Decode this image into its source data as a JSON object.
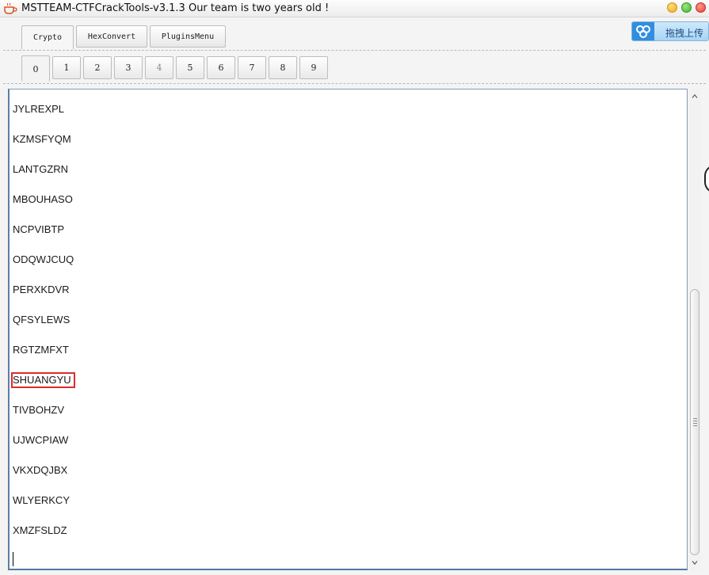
{
  "window": {
    "title": "MSTTEAM-CTFCrackTools-v3.1.3 Our team is two years old !"
  },
  "main_tabs": [
    {
      "label": "Crypto",
      "active": true
    },
    {
      "label": "HexConvert",
      "active": false
    },
    {
      "label": "PluginsMenu",
      "active": false
    }
  ],
  "upload": {
    "label": "拖拽上传"
  },
  "sub_tabs": [
    {
      "label": "0",
      "active": true
    },
    {
      "label": "1"
    },
    {
      "label": "2"
    },
    {
      "label": "3"
    },
    {
      "label": "4",
      "disabled": true
    },
    {
      "label": "5"
    },
    {
      "label": "6"
    },
    {
      "label": "7"
    },
    {
      "label": "8"
    },
    {
      "label": "9"
    }
  ],
  "output_lines": [
    "JYLREXPL",
    "KZMSFYQM",
    "LANTGZRN",
    "MBOUHASO",
    "NCPVIBTP",
    "ODQWJCUQ",
    "PERXKDVR",
    "QFSYLEWS",
    "RGTZMFXT",
    "SHUANGYU",
    "TIVBOHZV",
    "UJWCPIAW",
    "VKXDQJBX",
    "WLYERKCY",
    "XMZFSLDZ"
  ],
  "highlighted_line": "SHUANGYU",
  "colors": {
    "highlight_border": "#e02a2a",
    "text_border": "#5b7fa6"
  }
}
